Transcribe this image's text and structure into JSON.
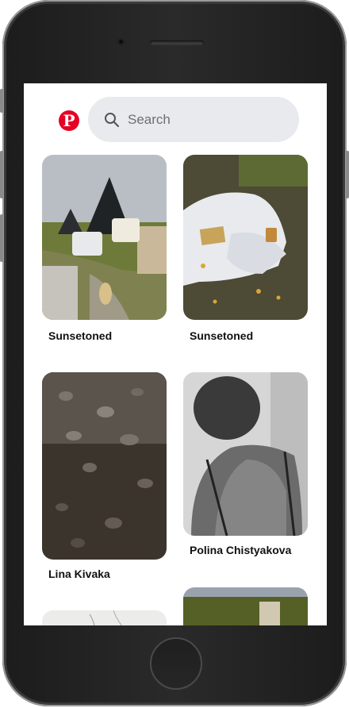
{
  "search": {
    "placeholder": "Search"
  },
  "pins": [
    {
      "author": "Sunsetoned"
    },
    {
      "author": "Sunsetoned"
    },
    {
      "author": "Lina Kivaka"
    },
    {
      "author": "Polina Chistyakova"
    }
  ],
  "colors": {
    "brand": "#e60023",
    "search_bg": "#e9eaee"
  }
}
